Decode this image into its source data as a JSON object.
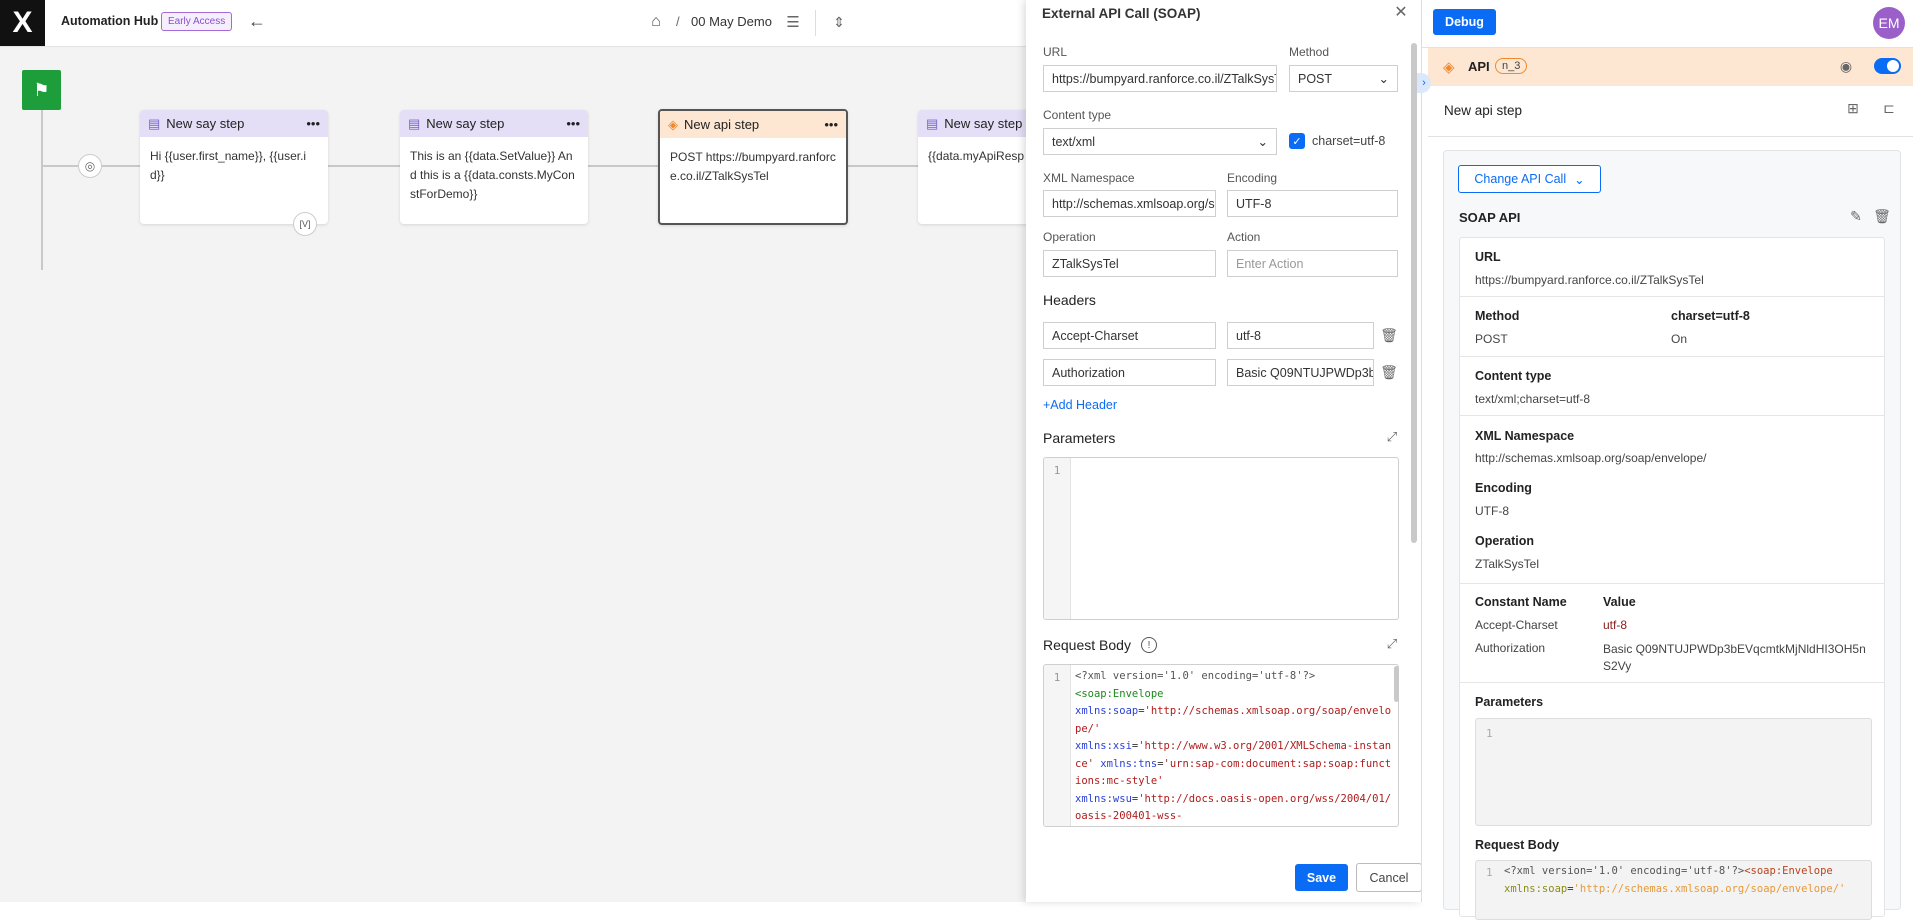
{
  "app": {
    "title": "Automation Hub",
    "badge": "Early Access",
    "breadcrumb_sep": "/",
    "project": "00 May Demo"
  },
  "flow": {
    "cards": [
      {
        "title": "New say step",
        "body": "Hi {{user.first_name}}, {{user.id}}",
        "type": "say"
      },
      {
        "title": "New say step",
        "body": "This is an {{data.SetValue}} And this is a {{data.consts.MyConstForDemo}}",
        "type": "say"
      },
      {
        "title": "New api step",
        "body": "POST https://bumpyard.ranforce.co.il/ZTalkSysTel",
        "type": "api"
      },
      {
        "title": "New say step",
        "body": "{{data.myApiResp",
        "type": "say"
      }
    ],
    "variable_badge": "[V]"
  },
  "modal": {
    "title": "External API Call (SOAP)",
    "url_label": "URL",
    "url_value": "https://bumpyard.ranforce.co.il/ZTalkSysTel",
    "method_label": "Method",
    "method_value": "POST",
    "content_type_label": "Content type",
    "content_type_value": "text/xml",
    "charset_label": "charset=utf-8",
    "charset_checked": true,
    "ns_label": "XML Namespace",
    "ns_value": "http://schemas.xmlsoap.org/soap/envelope/",
    "encoding_label": "Encoding",
    "encoding_value": "UTF-8",
    "operation_label": "Operation",
    "operation_value": "ZTalkSysTel",
    "action_label": "Action",
    "action_placeholder": "Enter Action",
    "headers_label": "Headers",
    "headers": [
      {
        "name": "Accept-Charset",
        "value": "utf-8"
      },
      {
        "name": "Authorization",
        "value": "Basic Q09NTUJPWDp3bEVqcmtkMjNldHI3OH5nS2Vy"
      }
    ],
    "add_header": "+Add Header",
    "parameters_label": "Parameters",
    "parameters_line": "1",
    "request_body_label": "Request Body",
    "request_body_line": "1",
    "request_body": [
      [
        {
          "t": "<?xml version='1.0' encoding='utf-8'?>",
          "c": "c-pi"
        }
      ],
      [
        {
          "t": "<soap:Envelope",
          "c": "c-tag"
        }
      ],
      [
        {
          "t": "xmlns:soap",
          "c": "c-attr"
        },
        {
          "t": "=",
          "c": "c-eq"
        },
        {
          "t": "'http://schemas.xmlsoap.org/soap/envelope/'",
          "c": "c-str"
        }
      ],
      [
        {
          "t": "xmlns:xsi",
          "c": "c-attr"
        },
        {
          "t": "=",
          "c": "c-eq"
        },
        {
          "t": "'http://www.w3.org/2001/XMLSchema-instance' ",
          "c": "c-str"
        },
        {
          "t": "xmlns:tns",
          "c": "c-attr"
        },
        {
          "t": "=",
          "c": "c-eq"
        },
        {
          "t": "'urn:sap-com:document:sap:soap:functions:mc-style'",
          "c": "c-str"
        }
      ],
      [
        {
          "t": "xmlns:wsu",
          "c": "c-attr"
        },
        {
          "t": "=",
          "c": "c-eq"
        },
        {
          "t": "'http://docs.oasis-open.org/wss/2004/01/oasis-200401-wss-",
          "c": "c-str"
        }
      ]
    ],
    "save": "Save",
    "cancel": "Cancel"
  },
  "right": {
    "debug": "Debug",
    "avatar": "EM",
    "node_type": "API",
    "node_id": "n_3",
    "enabled": true,
    "step_name": "New api step",
    "change_api": "Change API Call",
    "api_kind": "SOAP API",
    "url_label": "URL",
    "url_value": "https://bumpyard.ranforce.co.il/ZTalkSysTel",
    "method_label": "Method",
    "method_value": "POST",
    "charset_label": "charset=utf-8",
    "charset_value": "On",
    "content_type_label": "Content type",
    "content_type_value": "text/xml;charset=utf-8",
    "ns_label": "XML Namespace",
    "ns_value": "http://schemas.xmlsoap.org/soap/envelope/",
    "encoding_label": "Encoding",
    "encoding_value": "UTF-8",
    "operation_label": "Operation",
    "operation_value": "ZTalkSysTel",
    "const_name_label": "Constant Name",
    "const_value_label": "Value",
    "constants": [
      {
        "name": "Accept-Charset",
        "value": "utf-8"
      },
      {
        "name": "Authorization",
        "value": "Basic Q09NTUJPWDp3bEVqcmtkMjNldHI3OH5nS2Vy"
      }
    ],
    "parameters_label": "Parameters",
    "parameters_line": "1",
    "request_body_label": "Request Body",
    "request_body_line": "1",
    "request_body": [
      [
        {
          "t": "<?xml version='1.0' encoding='utf-8'?>",
          "c": "c-pi"
        },
        {
          "t": "<soap:Envelope",
          "c": "r-tag"
        }
      ],
      [
        {
          "t": "xmlns:soap",
          "c": "r-attr"
        },
        {
          "t": "=",
          "c": "c-eq"
        },
        {
          "t": "'http://schemas.xmlsoap.org/soap/envelope/'",
          "c": "r-str"
        }
      ]
    ]
  },
  "colors": {
    "accent": "#0a6cf5",
    "say_header": "#e4def6",
    "api_header": "#fde6d2",
    "start_flag": "#1e9e3a",
    "avatar": "#9b5fc9"
  }
}
